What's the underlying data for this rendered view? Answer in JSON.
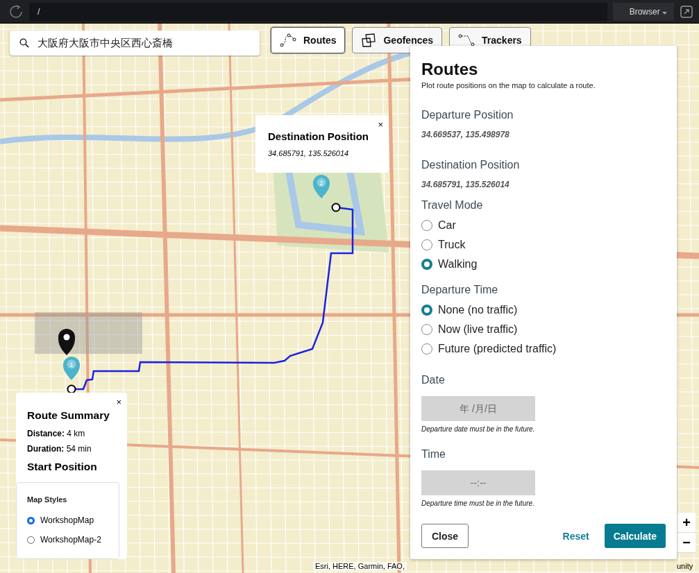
{
  "top_bar": {
    "path": "/",
    "browser_menu": "Browser"
  },
  "search": {
    "value": "大阪府大阪市中央区西心斎橋"
  },
  "tabs": [
    {
      "label": "Routes",
      "kind": "routes",
      "selected": true
    },
    {
      "label": "Geofences",
      "kind": "geofences",
      "selected": false
    },
    {
      "label": "Trackers",
      "kind": "trackers",
      "selected": false
    }
  ],
  "map": {
    "markers": [
      {
        "label": "1"
      },
      {
        "label": "2"
      }
    ],
    "attribution": "Esri, HERE, Garmin, FAO,",
    "attribution_end": "unity"
  },
  "destination_popup": {
    "close": "×",
    "title": "Destination Position",
    "coordinates": "34.685791, 135.526014"
  },
  "summary_popup": {
    "close": "×",
    "title": "Route Summary",
    "rows": [
      {
        "label": "Distance:",
        "value": "4 km"
      },
      {
        "label": "Duration:",
        "value": "54 min"
      }
    ],
    "subtitle": "Start Position"
  },
  "map_styles": {
    "title": "Map Styles",
    "options": [
      {
        "label": "WorkshopMap",
        "selected": true
      },
      {
        "label": "WorkshopMap-2",
        "selected": false
      }
    ]
  },
  "panel": {
    "title": "Routes",
    "subtitle": "Plot route positions on the map to calculate a route.",
    "departure": {
      "label": "Departure Position",
      "value": "34.669537, 135.498978"
    },
    "destination": {
      "label": "Destination Position",
      "value": "34.685791, 135.526014"
    },
    "travel_mode": {
      "label": "Travel Mode",
      "options": [
        {
          "label": "Car",
          "selected": false
        },
        {
          "label": "Truck",
          "selected": false
        },
        {
          "label": "Walking",
          "selected": true
        }
      ]
    },
    "departure_time": {
      "label": "Departure Time",
      "options": [
        {
          "label": "None (no traffic)",
          "selected": true
        },
        {
          "label": "Now (live traffic)",
          "selected": false
        },
        {
          "label": "Future (predicted traffic)",
          "selected": false
        }
      ]
    },
    "date": {
      "label": "Date",
      "placeholder": "年 /月/日",
      "hint": "Departure date must be in the future."
    },
    "time": {
      "label": "Time",
      "placeholder": "--:--",
      "hint": "Departure time must be in the future."
    },
    "buttons": {
      "close": "Close",
      "reset": "Reset",
      "calculate": "Calculate"
    }
  },
  "zoom": {
    "in": "+",
    "out": "−"
  }
}
